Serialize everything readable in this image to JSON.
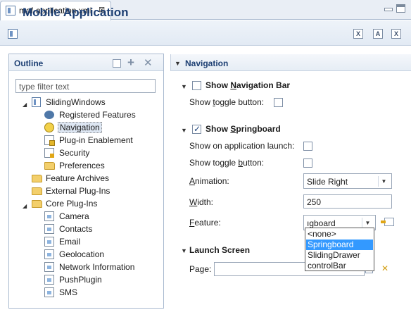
{
  "editor": {
    "tab_title": "maf-application.xml",
    "close_glyph": "⊠"
  },
  "header": {
    "title": "Mobile Application"
  },
  "outline": {
    "title": "Outline",
    "filter_placeholder": "type filter text",
    "tree": [
      {
        "label": "SlidingWindows",
        "icon": "xml-file-icon"
      },
      {
        "label": "Registered Features",
        "icon": "gear-icon"
      },
      {
        "label": "Navigation",
        "icon": "navigation-icon",
        "selected": true
      },
      {
        "label": "Plug-in Enablement",
        "icon": "plugin-icon"
      },
      {
        "label": "Security",
        "icon": "security-icon"
      },
      {
        "label": "Preferences",
        "icon": "folder-icon"
      },
      {
        "label": "Feature Archives",
        "icon": "folder-icon"
      },
      {
        "label": "External Plug-Ins",
        "icon": "folder-icon"
      },
      {
        "label": "Core Plug-Ins",
        "icon": "folder-icon"
      },
      {
        "label": "Camera",
        "icon": "plugin-icon"
      },
      {
        "label": "Contacts",
        "icon": "plugin-icon"
      },
      {
        "label": "Email",
        "icon": "plugin-icon"
      },
      {
        "label": "Geolocation",
        "icon": "plugin-icon"
      },
      {
        "label": "Network Information",
        "icon": "plugin-icon"
      },
      {
        "label": "PushPlugin",
        "icon": "plugin-icon"
      },
      {
        "label": "SMS",
        "icon": "plugin-icon"
      }
    ]
  },
  "navigation": {
    "title": "Navigation",
    "nav_bar": {
      "title_pre": "Show ",
      "title_ul": "N",
      "title_post": "avigation Bar",
      "checked": false,
      "toggle_pre": "Show ",
      "toggle_ul": "t",
      "toggle_post": "oggle button:",
      "toggle_checked": false
    },
    "springboard": {
      "title_pre": "Show ",
      "title_ul": "S",
      "title_post": "pringboard",
      "checked": true,
      "launch_label": "Show on application launch:",
      "toggle_pre": "Show toggle ",
      "toggle_ul": "b",
      "toggle_post": "utton:",
      "animation_ul": "A",
      "animation_post": "nimation:",
      "animation_value": "Slide Right",
      "width_ul": "W",
      "width_post": "idth:",
      "width_value": "250",
      "feature_ul": "F",
      "feature_post": "eature:",
      "feature_value": "ıgboard",
      "feature_options": [
        "<none>",
        "Springboard",
        "SlidingDrawer",
        "controlBar"
      ],
      "feature_selected": "Springboard"
    },
    "launch_screen": {
      "title": "Launch Screen",
      "page_label": "Page:"
    }
  }
}
